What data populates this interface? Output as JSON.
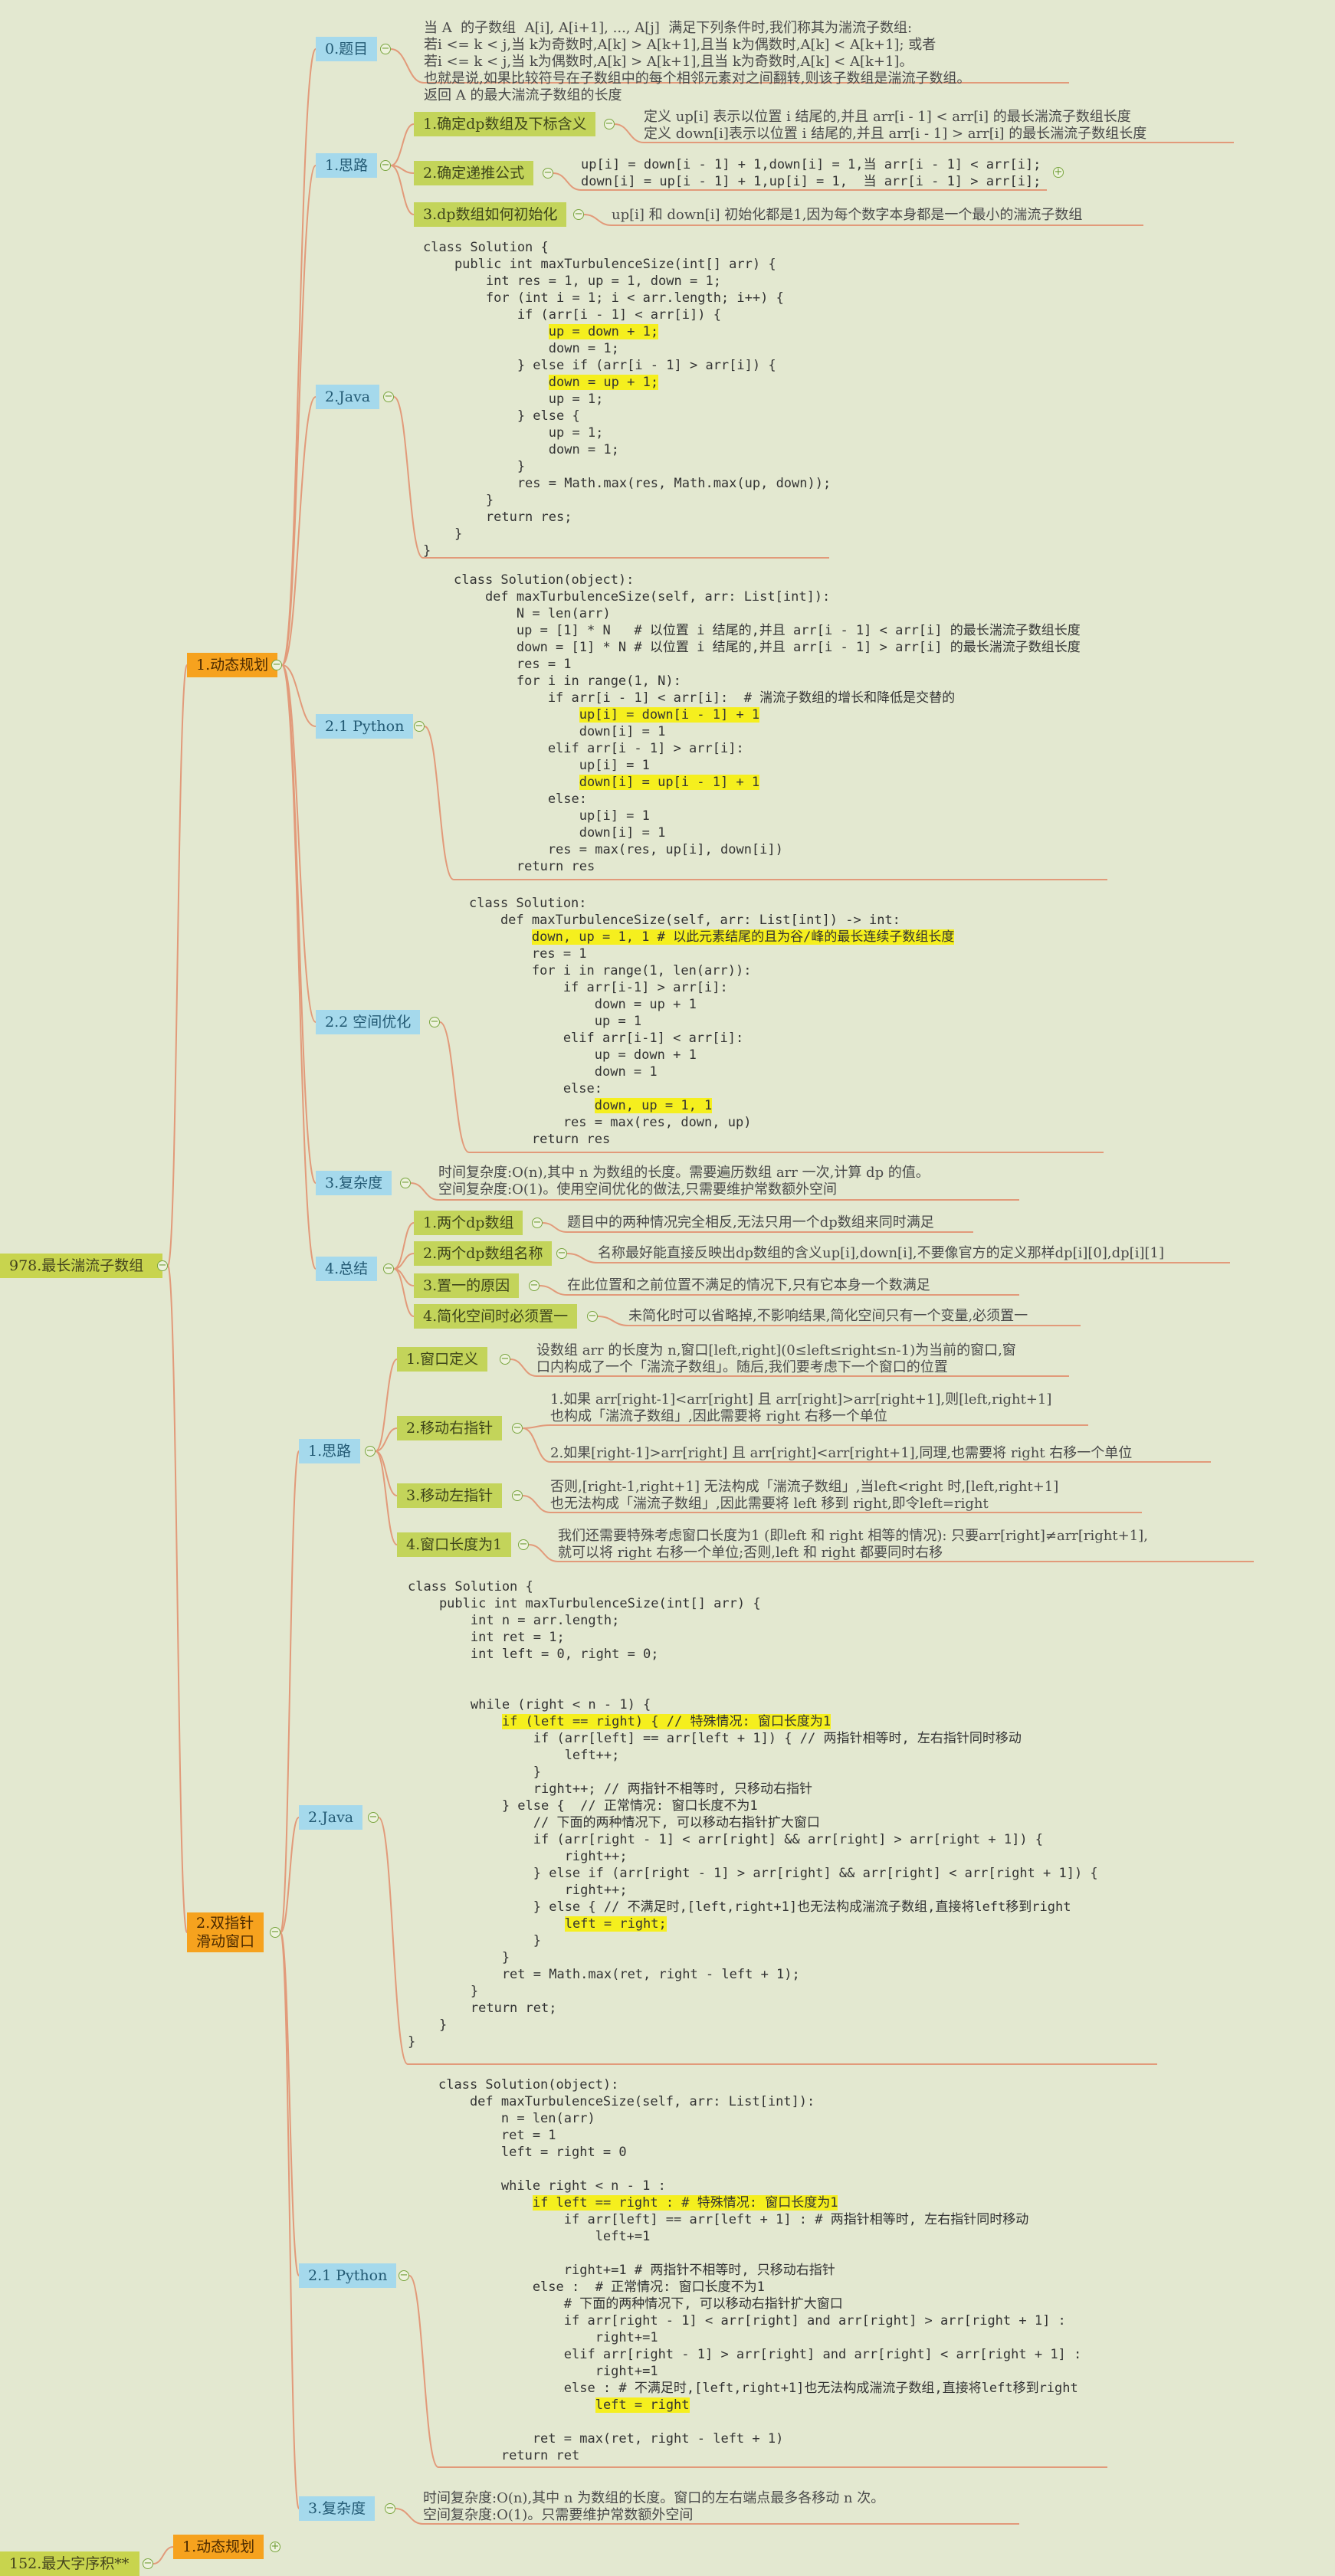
{
  "colors": {
    "link": "#e29a7a",
    "root": "#c8d44e",
    "level1": "#f6a21e",
    "level2": "#a5d9ec",
    "level3": "#c3d45a",
    "highlight": "#f5ef1e"
  },
  "root": {
    "label": "978.最长湍流子数组"
  },
  "next_root": {
    "label": "152.最大字序积**"
  },
  "next_child": {
    "label": "1.动态规划"
  },
  "dp": {
    "label": "1.动态规划",
    "problem": {
      "label": "0.题目",
      "lines": [
        "当 A  的子数组  A[i], A[i+1], ..., A[j]  满足下列条件时,我们称其为湍流子数组:",
        "若i <= k < j,当 k为奇数时,A[k] > A[k+1],且当 k为偶数时,A[k] < A[k+1]; 或者",
        "若i <= k < j,当 k为偶数时,A[k] > A[k+1],且当 k为奇数时,A[k] < A[k+1]。",
        "也就是说,如果比较符号在子数组中的每个相邻元素对之间翻转,则该子数组是湍流子数组。",
        "返回 A 的最大湍流子数组的长度"
      ]
    },
    "idea": {
      "label": "1.思路",
      "define": {
        "label": "1.确定dp数组及下标含义",
        "lines": [
          "定义 up[i] 表示以位置 i 结尾的,并且 arr[i - 1] < arr[i] 的最长湍流子数组长度",
          "定义 down[i]表示以位置 i 结尾的,并且 arr[i - 1] > arr[i] 的最长湍流子数组长度"
        ]
      },
      "formula": {
        "label": "2.确定递推公式",
        "lines": [
          "up[i] = down[i - 1] + 1,down[i] = 1,当 arr[i - 1] < arr[i];",
          "down[i] = up[i - 1] + 1,up[i] = 1,  当 arr[i - 1] > arr[i];"
        ]
      },
      "init": {
        "label": "3.dp数组如何初始化",
        "line": "up[i] 和 down[i] 初始化都是1,因为每个数字本身都是一个最小的湍流子数组"
      }
    },
    "java": {
      "label": "2.Java"
    },
    "python": {
      "label": "2.1 Python"
    },
    "space": {
      "label": "2.2 空间优化"
    },
    "complexity": {
      "label": "3.复杂度",
      "lines": [
        "时间复杂度:O(n),其中 n 为数组的长度。需要遍历数组 arr 一次,计算 dp 的值。",
        "空间复杂度:O(1)。使用空间优化的做法,只需要维护常数额外空间"
      ]
    },
    "summary": {
      "label": "4.总结",
      "items": [
        {
          "label": "1.两个dp数组",
          "text": "题目中的两种情况完全相反,无法只用一个dp数组来同时满足"
        },
        {
          "label": "2.两个dp数组名称",
          "text": "名称最好能直接反映出dp数组的含义up[i],down[i],不要像官方的定义那样dp[i][0],dp[i][1]"
        },
        {
          "label": "3.置一的原因",
          "text": "在此位置和之前位置不满足的情况下,只有它本身一个数满足"
        },
        {
          "label": "4.简化空间时必须置一",
          "text": "未简化时可以省略掉,不影响结果,简化空间只有一个变量,必须置一"
        }
      ]
    }
  },
  "tp": {
    "label1": "2.双指针",
    "label2": "滑动窗口",
    "idea": {
      "label": "1.思路",
      "items": [
        {
          "label": "1.窗口定义",
          "lines": [
            "设数组 arr 的长度为 n,窗口[left,right](0≤left≤right≤n-1)为当前的窗口,窗",
            "口内构成了一个「湍流子数组」。随后,我们要考虑下一个窗口的位置"
          ]
        },
        {
          "label": "2.移动右指针",
          "lines": [
            "1.如果 arr[right-1]<arr[right] 且 arr[right]>arr[right+1],则[left,right+1]",
            "也构成「湍流子数组」,因此需要将 right 右移一个单位",
            "2.如果[right-1]>arr[right] 且 arr[right]<arr[right+1],同理,也需要将 right 右移一个单位"
          ]
        },
        {
          "label": "3.移动左指针",
          "lines": [
            "否则,[right-1,right+1] 无法构成「湍流子数组」,当left<right 时,[left,right+1]",
            "也无法构成「湍流子数组」,因此需要将 left 移到 right,即令left=right"
          ]
        },
        {
          "label": "4.窗口长度为1",
          "lines": [
            "我们还需要特殊考虑窗口长度为1 (即left 和 right 相等的情况): 只要arr[right]≠arr[right+1],",
            "就可以将 right 右移一个单位;否则,left 和 right 都要同时右移"
          ]
        }
      ]
    },
    "java": {
      "label": "2.Java"
    },
    "python": {
      "label": "2.1 Python"
    },
    "complexity": {
      "label": "3.复杂度",
      "lines": [
        "时间复杂度:O(n),其中 n 为数组的长度。窗口的左右端点最多各移动 n 次。",
        "空间复杂度:O(1)。只需要维护常数额外空间"
      ]
    }
  },
  "code": {
    "dp_java": [
      "class Solution {",
      "    public int maxTurbulenceSize(int[] arr) {",
      "        int res = 1, up = 1, down = 1;",
      "        for (int i = 1; i < arr.length; i++) {",
      "            if (arr[i - 1] < arr[i]) {",
      "                up = down + 1;",
      "                down = 1;",
      "            } else if (arr[i - 1] > arr[i]) {",
      "                down = up + 1;",
      "                up = 1;",
      "            } else {",
      "                up = 1;",
      "                down = 1;",
      "            }",
      "            res = Math.max(res, Math.max(up, down));",
      "        }",
      "        return res;",
      "    }",
      "}"
    ],
    "dp_python": [
      "class Solution(object):",
      "    def maxTurbulenceSize(self, arr: List[int]):",
      "        N = len(arr)",
      "        up = [1] * N   # 以位置 i 结尾的,并且 arr[i - 1] < arr[i] 的最长湍流子数组长度",
      "        down = [1] * N # 以位置 i 结尾的,并且 arr[i - 1] > arr[i] 的最长湍流子数组长度",
      "        res = 1",
      "        for i in range(1, N):",
      "            if arr[i - 1] < arr[i]:  # 湍流子数组的增长和降低是交替的",
      "                up[i] = down[i - 1] + 1",
      "                down[i] = 1",
      "            elif arr[i - 1] > arr[i]:",
      "                up[i] = 1",
      "                down[i] = up[i - 1] + 1",
      "            else:",
      "                up[i] = 1",
      "                down[i] = 1",
      "            res = max(res, up[i], down[i])",
      "        return res"
    ],
    "dp_space": [
      "class Solution:",
      "    def maxTurbulenceSize(self, arr: List[int]) -> int:",
      "        down, up = 1, 1 # 以此元素结尾的且为谷/峰的最长连续子数组长度",
      "        res = 1",
      "        for i in range(1, len(arr)):",
      "            if arr[i-1] > arr[i]:",
      "                down = up + 1",
      "                up = 1",
      "            elif arr[i-1] < arr[i]:",
      "                up = down + 1",
      "                down = 1",
      "            else:",
      "                down, up = 1, 1",
      "            res = max(res, down, up)",
      "        return res"
    ],
    "tp_java": [
      "class Solution {",
      "    public int maxTurbulenceSize(int[] arr) {",
      "        int n = arr.length;",
      "        int ret = 1;",
      "        int left = 0, right = 0;",
      "",
      "",
      "        while (right < n - 1) {",
      "            if (left == right) { // 特殊情况: 窗口长度为1",
      "                if (arr[left] == arr[left + 1]) { // 两指针相等时, 左右指针同时移动",
      "                    left++;",
      "                }",
      "                right++; // 两指针不相等时, 只移动右指针",
      "            } else {  // 正常情况: 窗口长度不为1",
      "                // 下面的两种情况下, 可以移动右指针扩大窗口",
      "                if (arr[right - 1] < arr[right] && arr[right] > arr[right + 1]) {",
      "                    right++;",
      "                } else if (arr[right - 1] > arr[right] && arr[right] < arr[right + 1]) {",
      "                    right++;",
      "                } else { // 不满足时,[left,right+1]也无法构成湍流子数组,直接将left移到right",
      "                    left = right;",
      "                }",
      "            }",
      "            ret = Math.max(ret, right - left + 1);",
      "        }",
      "        return ret;",
      "    }",
      "}"
    ],
    "tp_python": [
      "class Solution(object):",
      "    def maxTurbulenceSize(self, arr: List[int]):",
      "        n = len(arr)",
      "        ret = 1",
      "        left = right = 0",
      "",
      "        while right < n - 1 :",
      "            if left == right : # 特殊情况: 窗口长度为1",
      "                if arr[left] == arr[left + 1] : # 两指针相等时, 左右指针同时移动",
      "                    left+=1",
      "",
      "                right+=1 # 两指针不相等时, 只移动右指针",
      "            else :  # 正常情况: 窗口长度不为1",
      "                # 下面的两种情况下, 可以移动右指针扩大窗口",
      "                if arr[right - 1] < arr[right] and arr[right] > arr[right + 1] :",
      "                    right+=1",
      "                elif arr[right - 1] > arr[right] and arr[right] < arr[right + 1] :",
      "                    right+=1",
      "                else : # 不满足时,[left,right+1]也无法构成湍流子数组,直接将left移到right",
      "                    left = right",
      "",
      "            ret = max(ret, right - left + 1)",
      "        return ret"
    ]
  }
}
